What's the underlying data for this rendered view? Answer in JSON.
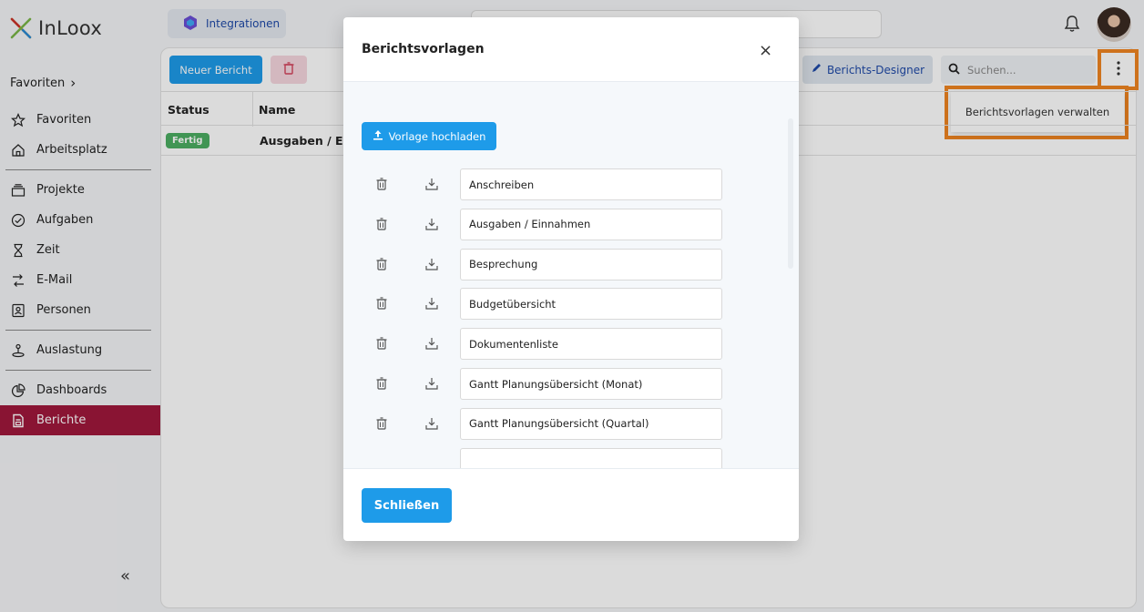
{
  "app": {
    "name": "InLoox"
  },
  "sidebar": {
    "favorites_header": "Favoriten",
    "groups": [
      [
        {
          "label": "Favoriten",
          "icon": "star-icon"
        },
        {
          "label": "Arbeitsplatz",
          "icon": "home-icon"
        }
      ],
      [
        {
          "label": "Projekte",
          "icon": "projects-icon"
        },
        {
          "label": "Aufgaben",
          "icon": "check-circle-icon"
        },
        {
          "label": "Zeit",
          "icon": "hourglass-icon"
        },
        {
          "label": "E-Mail",
          "icon": "email-icon"
        },
        {
          "label": "Personen",
          "icon": "contact-icon"
        }
      ],
      [
        {
          "label": "Auslastung",
          "icon": "workload-icon"
        }
      ],
      [
        {
          "label": "Dashboards",
          "icon": "pie-chart-icon"
        },
        {
          "label": "Berichte",
          "icon": "report-icon",
          "active": true
        }
      ]
    ],
    "collapse_label": "«"
  },
  "topbar": {
    "integrations_label": "Integrationen"
  },
  "toolbar": {
    "new_report_label": "Neuer Bericht",
    "designer_label": "Berichts-Designer",
    "search_placeholder": "Suchen...",
    "menu_item": "Berichtsvorlagen verwalten"
  },
  "table": {
    "headers": {
      "status": "Status",
      "name": "Name"
    },
    "rows": [
      {
        "status": "Fertig",
        "name": "Ausgaben / Einn"
      }
    ]
  },
  "modal": {
    "title": "Berichtsvorlagen",
    "close_icon": "×",
    "upload_label": "Vorlage hochladen",
    "templates": [
      "Anschreiben",
      "Ausgaben / Einnahmen",
      "Besprechung",
      "Budgetübersicht",
      "Dokumentenliste",
      "Gantt Planungsübersicht (Monat)",
      "Gantt Planungsübersicht (Quartal)"
    ],
    "close_button": "Schließen"
  },
  "colors": {
    "accent": "#1e9be9",
    "active_nav": "#a0183c",
    "highlight": "#f08521",
    "status_done": "#4cae62"
  }
}
